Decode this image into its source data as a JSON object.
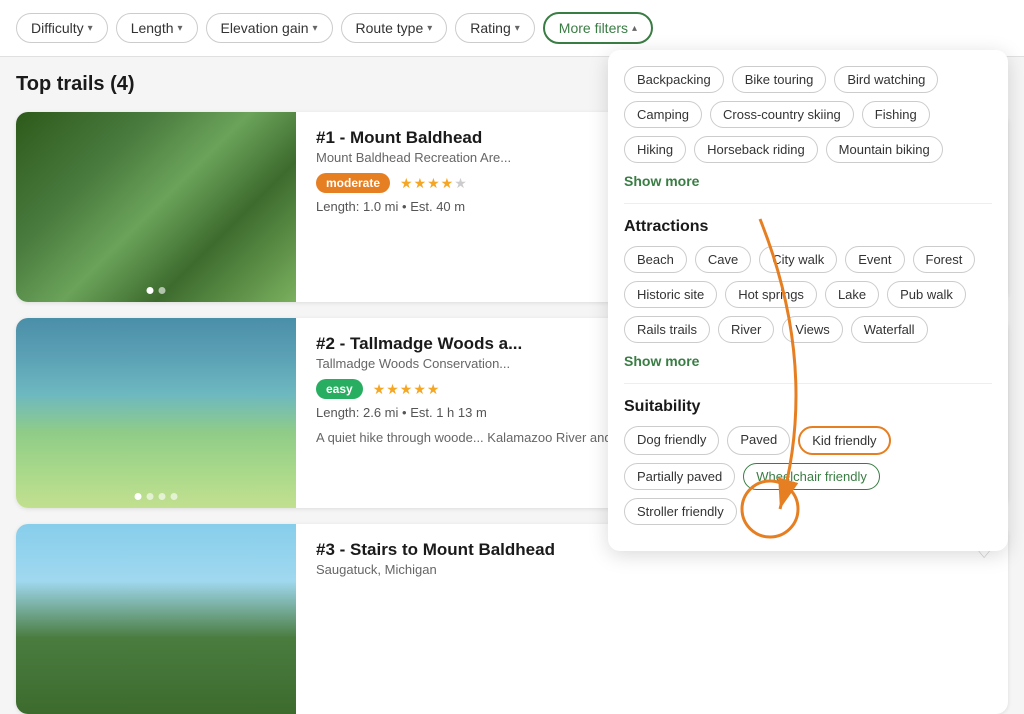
{
  "filters": {
    "buttons": [
      {
        "label": "Difficulty",
        "active": false
      },
      {
        "label": "Length",
        "active": false
      },
      {
        "label": "Elevation gain",
        "active": false
      },
      {
        "label": "Route type",
        "active": false
      },
      {
        "label": "Rating",
        "active": false
      },
      {
        "label": "More filters",
        "active": true
      }
    ]
  },
  "section_title": "Top trails (4)",
  "trails": [
    {
      "rank": "#1 - Mount Baldhead",
      "location": "Mount Baldhead Recreation Are...",
      "badge": "moderate",
      "badge_class": "badge-moderate",
      "stars": 4,
      "length": "Length: 1.0 mi",
      "est": "Est. 40 m",
      "desc": "",
      "heart_active": false,
      "dots": 2,
      "img_class": "img-forest"
    },
    {
      "rank": "#2 - Tallmadge Woods a...",
      "location": "Tallmadge Woods Conservation...",
      "badge": "easy",
      "badge_class": "badge-easy",
      "stars": 5,
      "length": "Length: 2.6 mi",
      "est": "Est. 1 h 13 m",
      "desc": "A quiet hike through woode... Kalamazoo River and mean...",
      "heart_active": true,
      "dots": 4,
      "img_class": "img-wetland"
    },
    {
      "rank": "#3 - Stairs to Mount Baldhead",
      "location": "Saugatuck, Michigan",
      "badge": "",
      "badge_class": "",
      "stars": 0,
      "length": "",
      "est": "",
      "desc": "",
      "heart_active": false,
      "dots": 0,
      "img_class": "img-mountain"
    }
  ],
  "dropdown": {
    "activities_title": "",
    "activities_tags": [
      "Backpacking",
      "Bike touring",
      "Bird watching",
      "Camping",
      "Cross-country skiing",
      "Fishing",
      "Hiking",
      "Horseback riding",
      "Mountain biking"
    ],
    "show_more_1": "Show more",
    "attractions_title": "Attractions",
    "attractions_tags": [
      "Beach",
      "Cave",
      "City walk",
      "Event",
      "Forest",
      "Historic site",
      "Hot springs",
      "Lake",
      "Pub walk",
      "Rails trails",
      "River",
      "Views",
      "Waterfall"
    ],
    "show_more_2": "Show more",
    "suitability_title": "Suitability",
    "suitability_tags": [
      {
        "label": "Dog friendly",
        "selected": false,
        "circled": false
      },
      {
        "label": "Paved",
        "selected": false,
        "circled": false
      },
      {
        "label": "Kid friendly",
        "selected": false,
        "circled": true
      },
      {
        "label": "Partially paved",
        "selected": false,
        "circled": false
      },
      {
        "label": "Wheelchair friendly",
        "selected": true,
        "circled": false
      },
      {
        "label": "Stroller friendly",
        "selected": false,
        "circled": false
      }
    ]
  }
}
